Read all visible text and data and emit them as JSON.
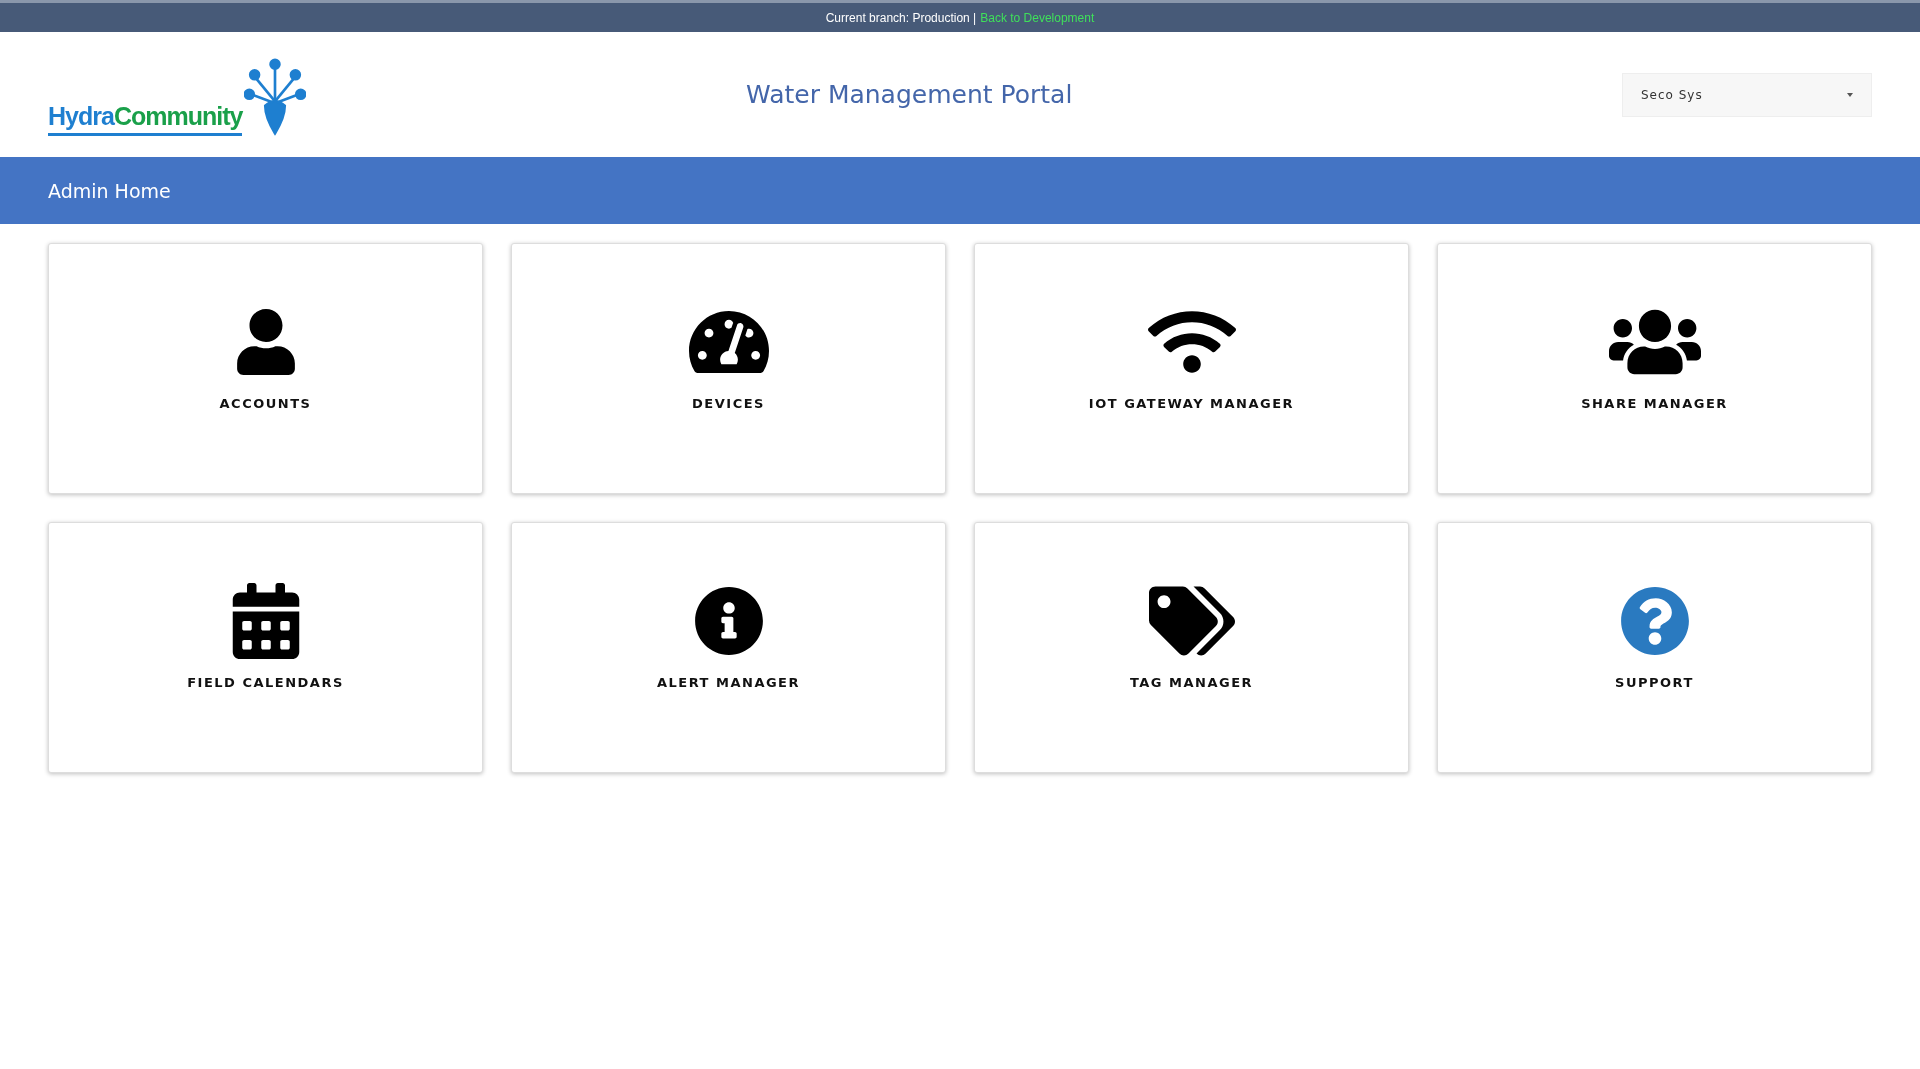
{
  "branch_bar": {
    "text": "Current branch: Production |",
    "link": "Back to Development"
  },
  "logo": {
    "parts": [
      {
        "text": "Hydra",
        "color": "#1e7fd0"
      },
      {
        "text": "Community",
        "color": "#1aa04a"
      }
    ]
  },
  "header": {
    "title": "Water Management Portal",
    "account_select": {
      "value": "Seco Sys"
    }
  },
  "page_bar": {
    "title": "Admin Home"
  },
  "tiles": [
    {
      "label": "ACCOUNTS"
    },
    {
      "label": "DEVICES"
    },
    {
      "label": "IOT GATEWAY MANAGER"
    },
    {
      "label": "SHARE MANAGER"
    },
    {
      "label": "FIELD CALENDARS"
    },
    {
      "label": "ALERT MANAGER"
    },
    {
      "label": "TAG MANAGER"
    },
    {
      "label": "SUPPORT"
    }
  ]
}
